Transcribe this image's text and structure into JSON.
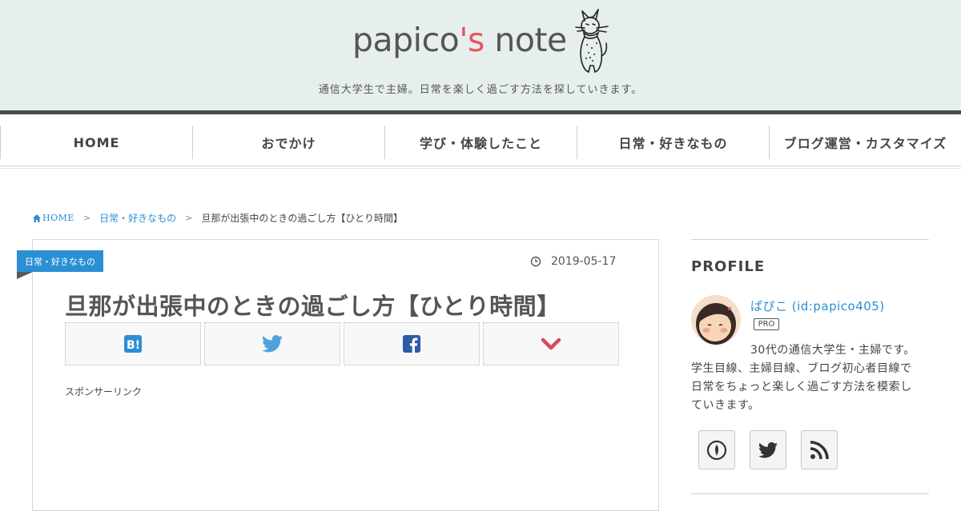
{
  "site": {
    "logo_main": "papico",
    "logo_accent": "'s",
    "logo_tail": " note",
    "tagline": "通信大学生で主婦。日常を楽しく過ごす方法を探していきます。"
  },
  "nav": {
    "items": [
      {
        "label": "HOME"
      },
      {
        "label": "おでかけ"
      },
      {
        "label": "学び・体験したこと"
      },
      {
        "label": "日常・好きなもの"
      },
      {
        "label": "ブログ運営・カスタマイズ"
      }
    ]
  },
  "breadcrumb": {
    "home": "HOME",
    "category": "日常・好きなもの",
    "current": "旦那が出張中のときの過ごし方【ひとり時間】"
  },
  "article": {
    "category_badge": "日常・好きなもの",
    "date": "2019-05-17",
    "title": "旦那が出張中のときの過ごし方【ひとり時間】",
    "sponsor_label": "スポンサーリンク",
    "share_buttons": [
      {
        "icon": "hatena-bookmark-icon",
        "color": "#2b8fd4"
      },
      {
        "icon": "twitter-icon",
        "color": "#4fa3dc"
      },
      {
        "icon": "facebook-icon",
        "color": "#2f5ba8"
      },
      {
        "icon": "chevron-down-icon",
        "color": "#d94a5a"
      }
    ]
  },
  "sidebar": {
    "heading": "PROFILE",
    "name": "ぱぴこ (id:papico405)",
    "badge": "PRO",
    "description_lines": [
      "30代の通信大学生・主婦です。",
      "学生目線、主婦目線、ブログ初心者目線で",
      "日常をちょっと楽しく過ごす方法を模索し",
      "ていきます。"
    ],
    "social": [
      {
        "icon": "hatena-icon"
      },
      {
        "icon": "twitter-icon"
      },
      {
        "icon": "rss-icon"
      }
    ]
  },
  "colors": {
    "header_bg": "#e6efee",
    "accent_blue": "#2b8fd4",
    "logo_accent": "#e8555a",
    "header_bar": "#4a4a4a"
  }
}
